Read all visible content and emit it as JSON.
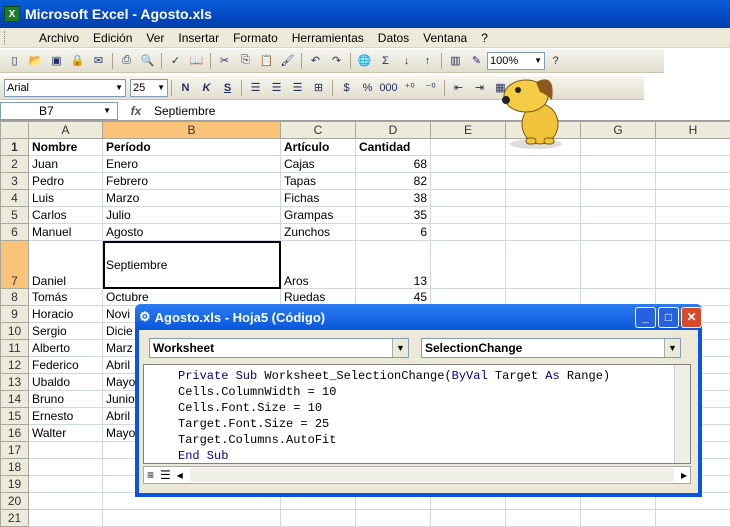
{
  "window": {
    "title": "Microsoft Excel - Agosto.xls",
    "app_icon": "excel-icon"
  },
  "menu": [
    "Archivo",
    "Edición",
    "Ver",
    "Insertar",
    "Formato",
    "Herramientas",
    "Datos",
    "Ventana",
    "?"
  ],
  "toolbar": {
    "zoom": "100%",
    "font": "Arial",
    "size": "25",
    "sigma": "Σ"
  },
  "formula": {
    "cell": "B7",
    "fx": "fx",
    "value": "Septiembre"
  },
  "columns": [
    "A",
    "B",
    "C",
    "D",
    "E",
    "F",
    "G",
    "H"
  ],
  "rows": [
    {
      "n": "1",
      "a": "Nombre",
      "b": "Período",
      "c": "Artículo",
      "d": "Cantidad"
    },
    {
      "n": "2",
      "a": "Juan",
      "b": "Enero",
      "c": "Cajas",
      "d": "68"
    },
    {
      "n": "3",
      "a": "Pedro",
      "b": "Febrero",
      "c": "Tapas",
      "d": "82"
    },
    {
      "n": "4",
      "a": "Luis",
      "b": "Marzo",
      "c": "Fichas",
      "d": "38"
    },
    {
      "n": "5",
      "a": "Carlos",
      "b": "Julio",
      "c": "Grampas",
      "d": "35"
    },
    {
      "n": "6",
      "a": "Manuel",
      "b": "Agosto",
      "c": "Zunchos",
      "d": "6"
    },
    {
      "n": "7",
      "a": "Daniel",
      "b": "Septiembre",
      "c": "Aros",
      "d": "13"
    },
    {
      "n": "8",
      "a": "Tomás",
      "b": "Octubre",
      "c": "Ruedas",
      "d": "45"
    },
    {
      "n": "9",
      "a": "Horacio",
      "b": "Novi",
      "c": "",
      "d": ""
    },
    {
      "n": "10",
      "a": "Sergio",
      "b": "Dicie",
      "c": "",
      "d": ""
    },
    {
      "n": "11",
      "a": "Alberto",
      "b": "Marz",
      "c": "",
      "d": ""
    },
    {
      "n": "12",
      "a": "Federico",
      "b": "Abril",
      "c": "",
      "d": ""
    },
    {
      "n": "13",
      "a": "Ubaldo",
      "b": "Mayo",
      "c": "",
      "d": ""
    },
    {
      "n": "14",
      "a": "Bruno",
      "b": "Junio",
      "c": "",
      "d": ""
    },
    {
      "n": "15",
      "a": "Ernesto",
      "b": "Abril",
      "c": "",
      "d": ""
    },
    {
      "n": "16",
      "a": "Walter",
      "b": "Mayo",
      "c": "",
      "d": ""
    },
    {
      "n": "17",
      "a": "",
      "b": "",
      "c": "",
      "d": ""
    },
    {
      "n": "18",
      "a": "",
      "b": "",
      "c": "",
      "d": ""
    },
    {
      "n": "19",
      "a": "",
      "b": "",
      "c": "",
      "d": ""
    },
    {
      "n": "20",
      "a": "",
      "b": "",
      "c": "",
      "d": ""
    },
    {
      "n": "21",
      "a": "",
      "b": "",
      "c": "",
      "d": ""
    }
  ],
  "vbe": {
    "title": "Agosto.xls - Hoja5 (Código)",
    "object": "Worksheet",
    "procedure": "SelectionChange",
    "code": [
      {
        "kw": "Private Sub ",
        "rest": "Worksheet_SelectionChange(",
        "kw2": "ByVal",
        "rest2": " Target ",
        "kw3": "As",
        "rest3": " Range)"
      },
      {
        "text": "Cells.ColumnWidth = 10"
      },
      {
        "text": "Cells.Font.Size = 10"
      },
      {
        "text": "Target.Font.Size = 25"
      },
      {
        "text": "Target.Columns.AutoFit"
      },
      {
        "kwline": "End Sub"
      }
    ]
  },
  "colors": {
    "title": "#0a5fd8",
    "select": "#f9c47a"
  }
}
